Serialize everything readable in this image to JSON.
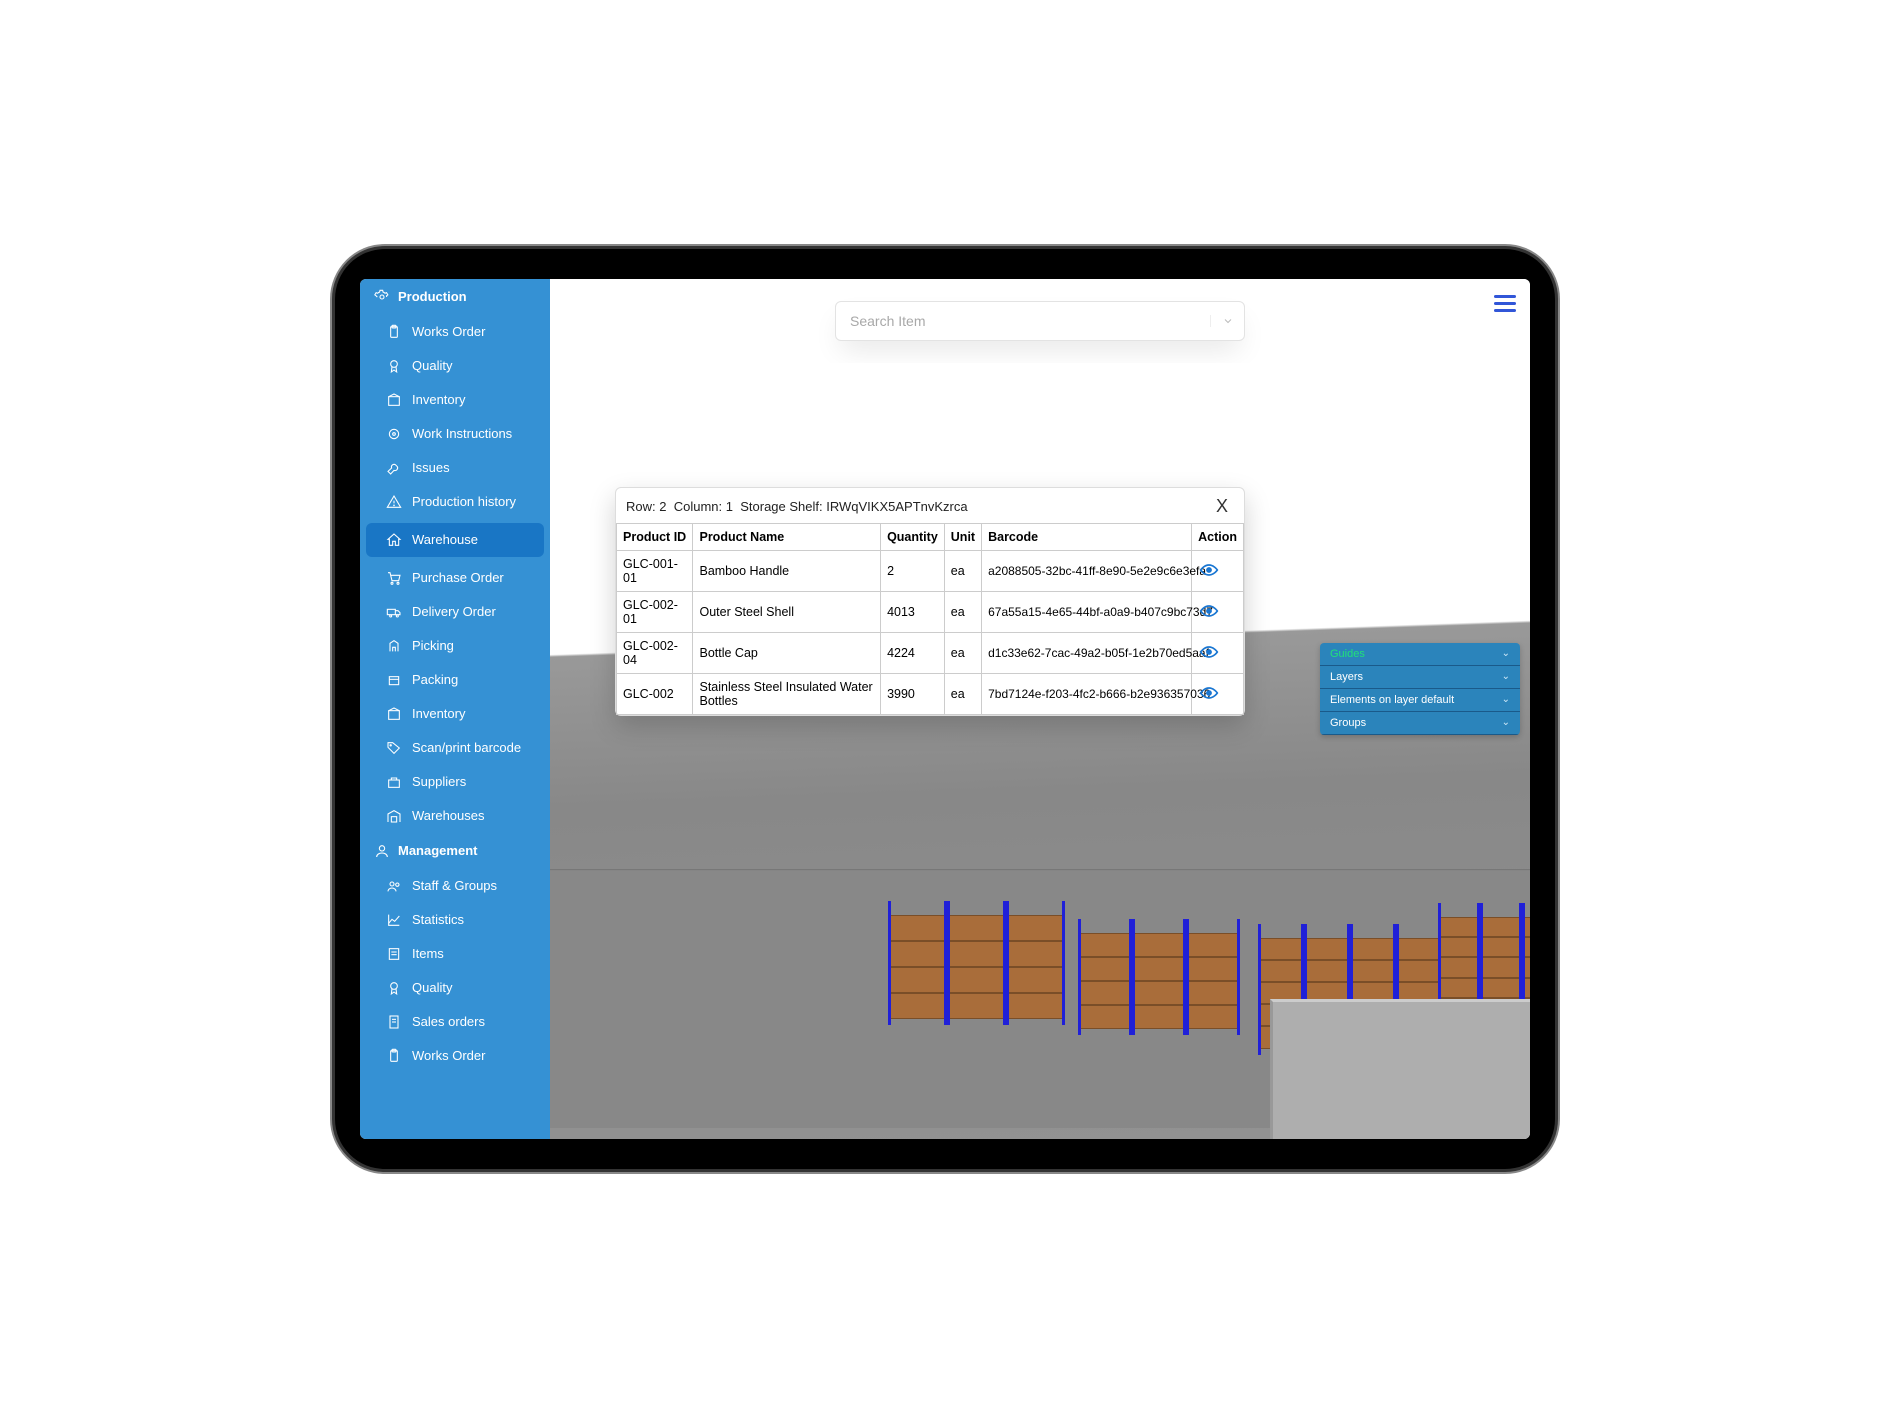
{
  "search": {
    "placeholder": "Search Item"
  },
  "sidebar": {
    "sections": [
      {
        "title": "Production",
        "icon": "gear-icon",
        "items": [
          {
            "label": "Works Order",
            "icon": "clipboard-icon"
          },
          {
            "label": "Quality",
            "icon": "badge-icon"
          },
          {
            "label": "Inventory",
            "icon": "inventory-icon"
          },
          {
            "label": "Work Instructions",
            "icon": "gear-outline-icon"
          },
          {
            "label": "Issues",
            "icon": "wrench-icon"
          },
          {
            "label": "Production history",
            "icon": "warning-icon"
          }
        ]
      },
      {
        "title": "Warehouse",
        "icon": "home-icon",
        "active": true,
        "items": [
          {
            "label": "Purchase Order",
            "icon": "cart-icon"
          },
          {
            "label": "Delivery Order",
            "icon": "truck-icon"
          },
          {
            "label": "Picking",
            "icon": "pick-icon"
          },
          {
            "label": "Packing",
            "icon": "box-icon"
          },
          {
            "label": "Inventory",
            "icon": "inventory-icon"
          },
          {
            "label": "Scan/print barcode",
            "icon": "tag-icon"
          },
          {
            "label": "Suppliers",
            "icon": "supplier-icon"
          },
          {
            "label": "Warehouses",
            "icon": "warehouse-icon"
          }
        ]
      },
      {
        "title": "Management",
        "icon": "person-icon",
        "items": [
          {
            "label": "Staff & Groups",
            "icon": "people-icon"
          },
          {
            "label": "Statistics",
            "icon": "chart-icon"
          },
          {
            "label": "Items",
            "icon": "list-icon"
          },
          {
            "label": "Quality",
            "icon": "badge-icon"
          },
          {
            "label": "Sales orders",
            "icon": "receipt-icon"
          },
          {
            "label": "Works Order",
            "icon": "clipboard-icon"
          }
        ]
      }
    ]
  },
  "popup": {
    "row_label": "Row:",
    "row_value": "2",
    "column_label": "Column:",
    "column_value": "1",
    "shelf_label": "Storage Shelf:",
    "shelf_value": "IRWqVIKX5APTnvKzrca",
    "columns": [
      "Product ID",
      "Product Name",
      "Quantity",
      "Unit",
      "Barcode",
      "Action"
    ],
    "rows": [
      {
        "id": "GLC-001-01",
        "name": "Bamboo Handle",
        "qty": "2",
        "unit": "ea",
        "barcode": "a2088505-32bc-41ff-8e90-5e2e9c6e3efa"
      },
      {
        "id": "GLC-002-01",
        "name": "Outer Steel Shell",
        "qty": "4013",
        "unit": "ea",
        "barcode": "67a55a15-4e65-44bf-a0a9-b407c9bc73d7"
      },
      {
        "id": "GLC-002-04",
        "name": "Bottle Cap",
        "qty": "4224",
        "unit": "ea",
        "barcode": "d1c33e62-7cac-49a2-b05f-1e2b70ed5aaf"
      },
      {
        "id": "GLC-002",
        "name": "Stainless Steel Insulated Water Bottles",
        "qty": "3990",
        "unit": "ea",
        "barcode": "7bd7124e-f203-4fc2-b666-b2e936357036"
      }
    ]
  },
  "panels": [
    {
      "label": "Guides",
      "class": "guides"
    },
    {
      "label": "Layers",
      "class": "normal"
    },
    {
      "label": "Elements on layer default",
      "class": "normal"
    },
    {
      "label": "Groups",
      "class": "normal"
    }
  ]
}
